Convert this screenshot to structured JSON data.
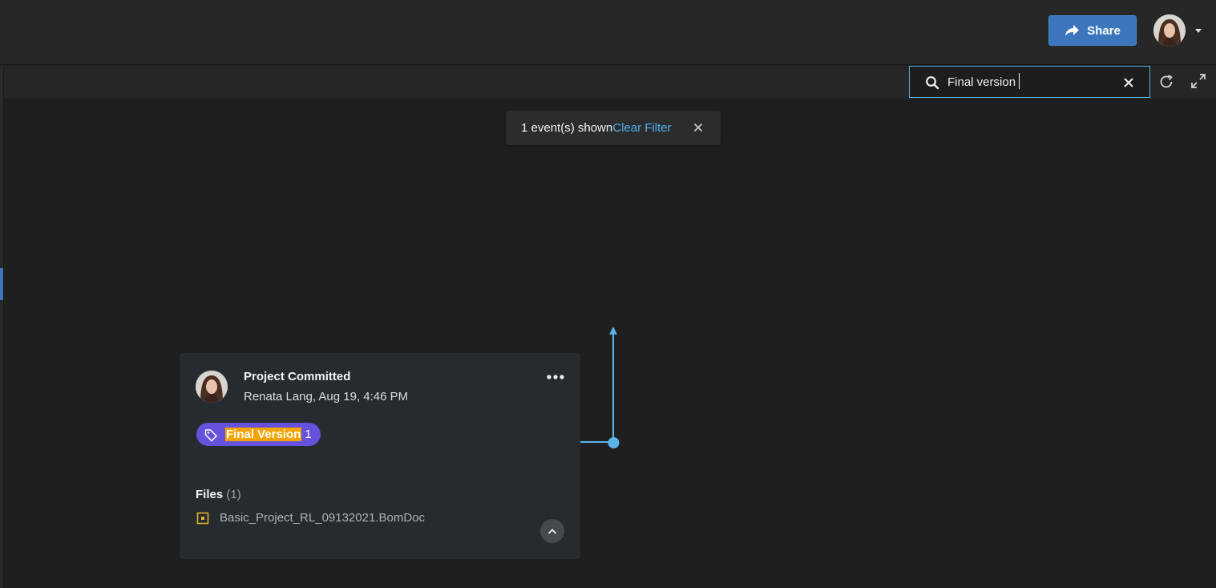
{
  "header": {
    "share_label": "Share"
  },
  "search": {
    "value": "Final version"
  },
  "filter_toast": {
    "count_text": "1 event(s) shown",
    "clear_label": "Clear Filter"
  },
  "event_card": {
    "title": "Project Committed",
    "subtitle": "Renata Lang, Aug 19, 4:46 PM",
    "tag": {
      "highlight": "Final Version",
      "suffix": "1"
    },
    "files_label": "Files",
    "files_count": "(1)",
    "files": [
      {
        "name": "Basic_Project_RL_09132021.BomDoc"
      }
    ]
  },
  "colors": {
    "accent_blue": "#3c76bd",
    "link_blue": "#4fb0ee",
    "tag_purple": "#6653dd",
    "highlight_orange": "#f4a400",
    "timeline_blue": "#5ab4e8"
  },
  "icons": {
    "share": "share-arrow-icon",
    "search": "search-icon",
    "clear": "close-icon",
    "refresh": "refresh-icon",
    "expand": "expand-icon",
    "more": "more-dots-icon",
    "tag": "tag-icon",
    "file": "file-icon",
    "collapse": "chevron-up-icon"
  }
}
